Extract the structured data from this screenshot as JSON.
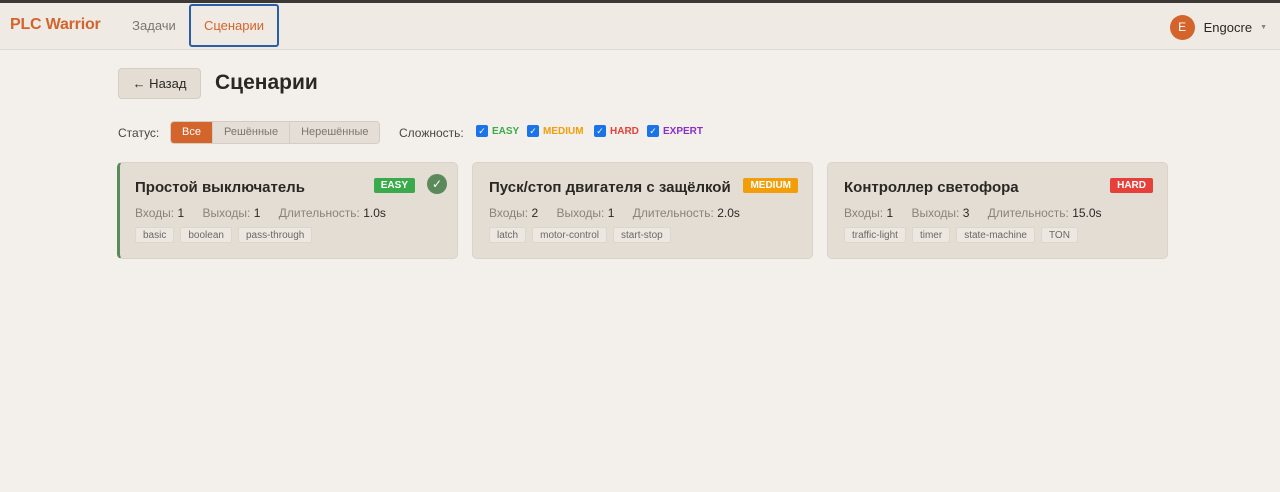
{
  "app": {
    "brand": "PLC Warrior"
  },
  "nav": {
    "tabs": [
      {
        "label": "Задачи"
      },
      {
        "label": "Сценарии"
      }
    ]
  },
  "user": {
    "initial": "E",
    "name": "Engocre"
  },
  "page": {
    "back_label": "← Назад",
    "title": "Сценарии"
  },
  "filters": {
    "status_label": "Статус:",
    "status_options": [
      {
        "label": "Все"
      },
      {
        "label": "Решённые"
      },
      {
        "label": "Нерешённые"
      }
    ],
    "difficulty_label": "Сложность:",
    "difficulties": [
      {
        "label": "EASY",
        "color": "#3aaa4a"
      },
      {
        "label": "MEDIUM",
        "color": "#f29d0a"
      },
      {
        "label": "HARD",
        "color": "#e5403a"
      },
      {
        "label": "EXPERT",
        "color": "#8a2fc7"
      }
    ]
  },
  "meta_labels": {
    "inputs": "Входы:",
    "outputs": "Выходы:",
    "duration": "Длительность:"
  },
  "scenarios": [
    {
      "title": "Простой выключатель",
      "difficulty": "EASY",
      "difficulty_color": "#3aaa4a",
      "solved": true,
      "inputs": "1",
      "outputs": "1",
      "duration": "1.0s",
      "tags": [
        "basic",
        "boolean",
        "pass-through"
      ]
    },
    {
      "title": "Пуск/стоп двигателя с защёлкой",
      "difficulty": "MEDIUM",
      "difficulty_color": "#f29d0a",
      "solved": false,
      "inputs": "2",
      "outputs": "1",
      "duration": "2.0s",
      "tags": [
        "latch",
        "motor-control",
        "start-stop"
      ]
    },
    {
      "title": "Контроллер светофора",
      "difficulty": "HARD",
      "difficulty_color": "#e5403a",
      "solved": false,
      "inputs": "1",
      "outputs": "3",
      "duration": "15.0s",
      "tags": [
        "traffic-light",
        "timer",
        "state-machine",
        "TON"
      ]
    }
  ]
}
